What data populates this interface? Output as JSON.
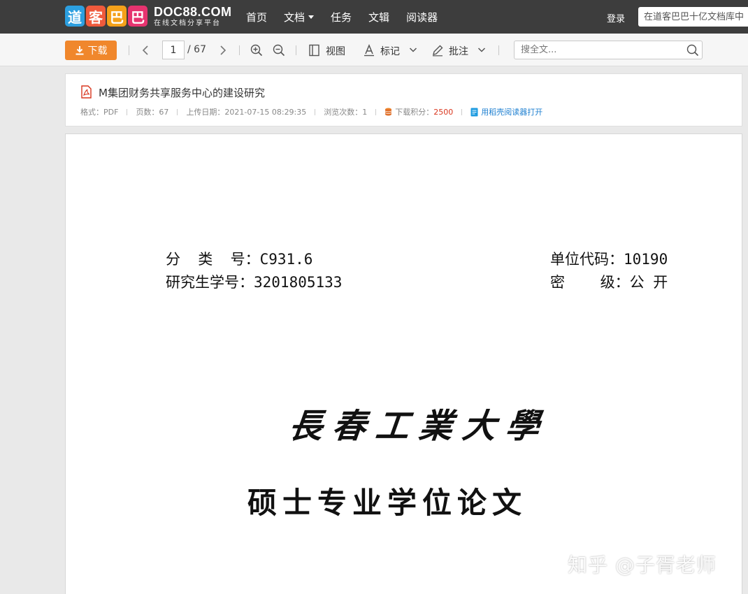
{
  "topbar": {
    "logo_chars": [
      "道",
      "客",
      "巴",
      "巴"
    ],
    "logo_colors": [
      "#2c9fe0",
      "#ef5a3c",
      "#f4a11a",
      "#e6336f"
    ],
    "logo_main": "DOC88.COM",
    "logo_sub": "在线文档分享平台",
    "nav": [
      {
        "label": "首页",
        "dropdown": false
      },
      {
        "label": "文档",
        "dropdown": true
      },
      {
        "label": "任务",
        "dropdown": false
      },
      {
        "label": "文辑",
        "dropdown": false
      },
      {
        "label": "阅读器",
        "dropdown": false
      }
    ],
    "login_label": "登录",
    "search_placeholder": "在道客巴巴十亿文档库中"
  },
  "toolbar": {
    "download_label": "下载",
    "page_current": "1",
    "page_total": "/ 67",
    "view_label": "视图",
    "mark_label": "标记",
    "annotate_label": "批注",
    "search_placeholder": "搜全文..."
  },
  "doc_info": {
    "title": "M集团财务共享服务中心的建设研究",
    "format": "格式：PDF",
    "pages": "页数：67",
    "upload_date": "上传日期：2021-07-15 08:29:35",
    "views": "浏览次数：1",
    "points_label": "下载积分：",
    "points_value": "2500",
    "open_reader": "用稻壳阅读器打开"
  },
  "page": {
    "class_no": "分  类  号：C931.6",
    "student_no": "研究生学号：3201805133",
    "unit_code": "单位代码：10190",
    "secret_level": "密    级：公 开",
    "university": "長春工業大學",
    "degree_title": "硕士专业学位论文"
  },
  "watermark": "知乎 @子胥老师",
  "colors": {
    "accent_orange": "#f0872c",
    "points_red": "#d9361e",
    "link_blue": "#1d7fd0",
    "topbar_bg": "#3d3d3d"
  }
}
